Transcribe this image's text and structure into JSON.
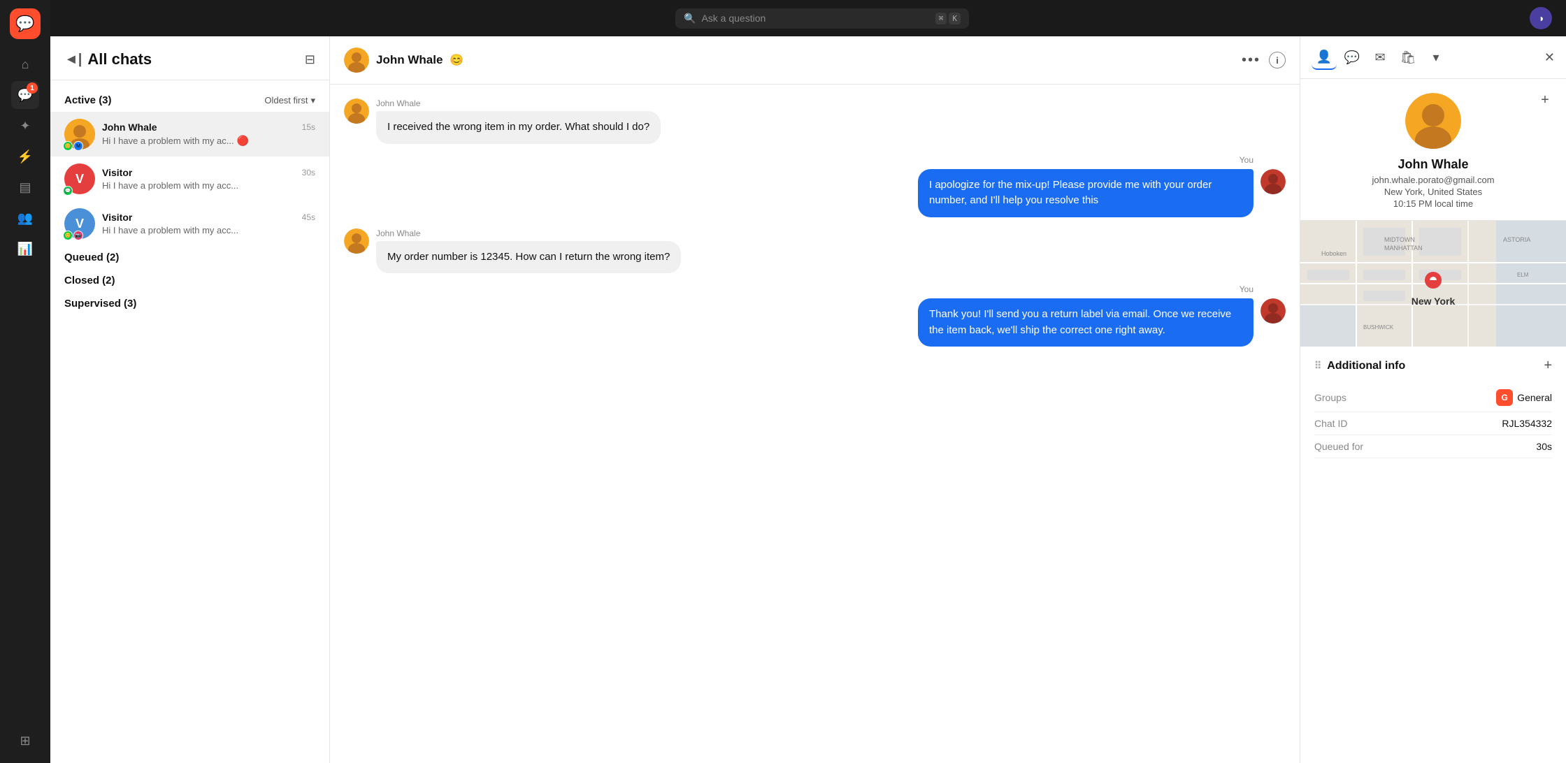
{
  "topbar": {
    "search_placeholder": "Ask a question",
    "kbd1": "⌘",
    "kbd2": "K"
  },
  "sidebar": {
    "logo": "💬",
    "items": [
      {
        "name": "home",
        "icon": "⌂",
        "active": false
      },
      {
        "name": "chats",
        "icon": "💬",
        "active": true,
        "badge": "1"
      },
      {
        "name": "magic",
        "icon": "✦",
        "active": false
      },
      {
        "name": "lightning",
        "icon": "⚡",
        "active": false
      },
      {
        "name": "archive",
        "icon": "▤",
        "active": false
      },
      {
        "name": "contacts",
        "icon": "👥",
        "active": false
      },
      {
        "name": "reports",
        "icon": "📊",
        "active": false
      },
      {
        "name": "widgets",
        "icon": "⊞",
        "active": false
      }
    ]
  },
  "chat_list": {
    "title": "All chats",
    "filter_icon": "⊞",
    "active_section": "Active (3)",
    "sort_label": "Oldest first",
    "chats": [
      {
        "id": "john-whale",
        "name": "John Whale",
        "time": "15s",
        "preview": "Hi I have a problem with my ac...",
        "avatar_color": "#f5a623",
        "has_image": true,
        "source_icons": [
          "😊",
          "📘"
        ],
        "urgent": true,
        "active": true
      },
      {
        "id": "visitor-1",
        "name": "Visitor",
        "time": "30s",
        "preview": "Hi I have a problem with my acc...",
        "avatar_color": "#e53e3e",
        "letter": "V",
        "has_image": false,
        "source_icons": [
          "💬"
        ],
        "urgent": false,
        "active": false
      },
      {
        "id": "visitor-2",
        "name": "Visitor",
        "time": "45s",
        "preview": "Hi I have a problem with my acc...",
        "avatar_color": "#4a90d9",
        "letter": "V",
        "has_image": false,
        "source_icons": [
          "😊",
          "📷"
        ],
        "urgent": false,
        "active": false
      }
    ],
    "queued_section": "Queued (2)",
    "closed_section": "Closed (2)",
    "supervised_section": "Supervised (3)"
  },
  "chat_window": {
    "contact_name": "John Whale",
    "messages": [
      {
        "id": "msg1",
        "sender": "John Whale",
        "text": "I received the wrong item in my order. What should I do?",
        "type": "incoming"
      },
      {
        "id": "msg2",
        "sender": "You",
        "text": "I apologize for the mix-up! Please provide me with your order number, and I'll help you resolve this",
        "type": "outgoing"
      },
      {
        "id": "msg3",
        "sender": "John Whale",
        "text": "My order number is 12345. How can I return the wrong item?",
        "type": "incoming"
      },
      {
        "id": "msg4",
        "sender": "You",
        "text": "Thank you! I'll send you a return label via email. Once we receive the item back, we'll ship the correct one right away.",
        "type": "outgoing"
      }
    ]
  },
  "right_panel": {
    "contact_name": "John Whale",
    "contact_email": "john.whale.porato@gmail.com",
    "contact_location": "New York, United States",
    "contact_local_time": "10:15 PM local time",
    "map_city": "New York",
    "additional_info": {
      "title": "Additional info",
      "rows": [
        {
          "label": "Groups",
          "value": "General",
          "type": "group_badge",
          "badge_letter": "G"
        },
        {
          "label": "Chat ID",
          "value": "RJL354332",
          "type": "text"
        },
        {
          "label": "Queued for",
          "value": "30s",
          "type": "text"
        }
      ]
    }
  }
}
